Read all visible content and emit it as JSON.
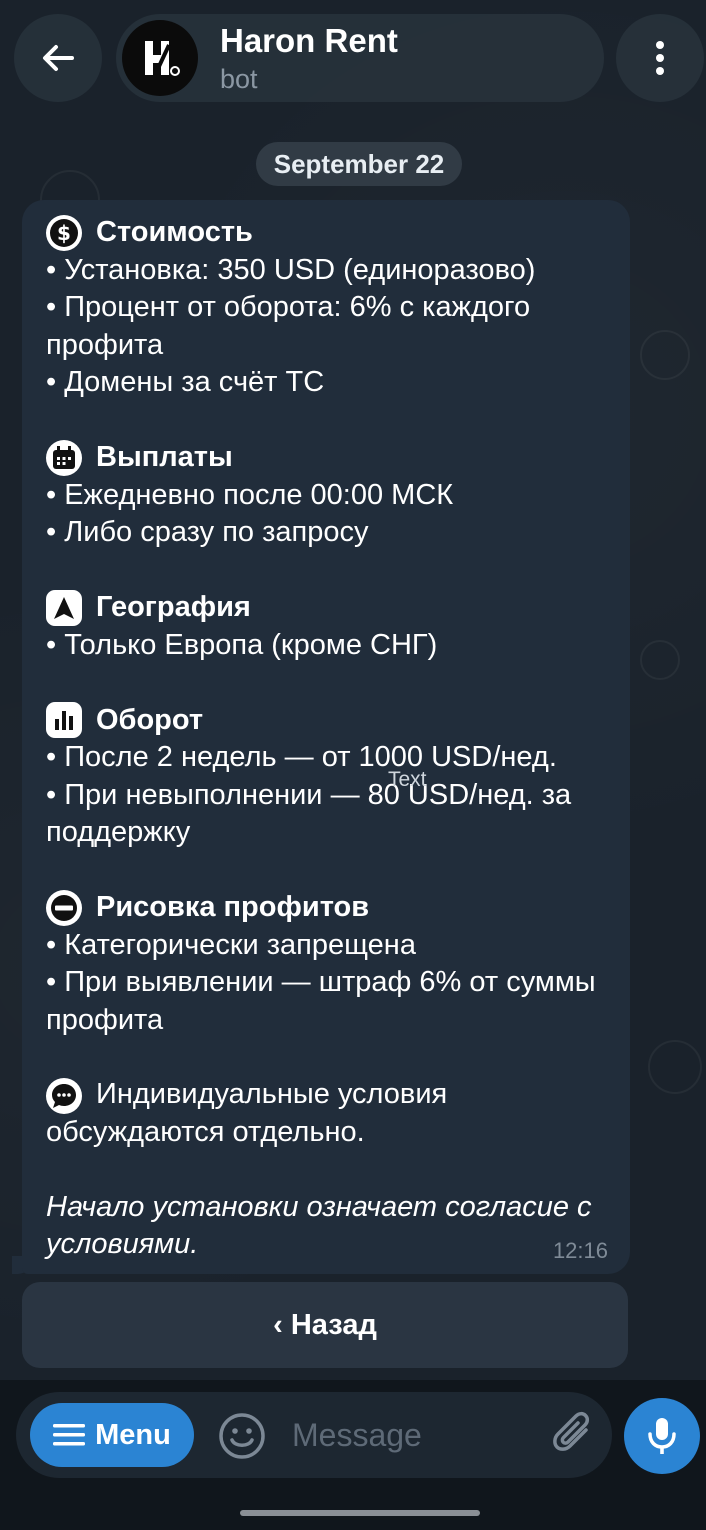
{
  "header": {
    "title": "Haron Rent",
    "subtitle": "bot"
  },
  "date_separator": "September 22",
  "message": {
    "sections": [
      {
        "icon": "dollar-icon",
        "heading": "Стоимость",
        "lines": [
          "• Установка: 350 USD (единоразово)",
          "• Процент от оборота: 6% с каждого профита",
          "• Домены за счёт ТС"
        ]
      },
      {
        "icon": "calendar-icon",
        "heading": "Выплаты",
        "lines": [
          "• Ежедневно после 00:00 МСК",
          "• Либо сразу по запросу"
        ]
      },
      {
        "icon": "navigation-arrow-icon",
        "heading": "География",
        "lines": [
          "• Только Европа (кроме СНГ)"
        ]
      },
      {
        "icon": "bar-chart-icon",
        "heading": "Оборот",
        "lines": [
          "• После 2 недель — от 1000 USD/нед.",
          "• При невыполнении — 80 USD/нед. за поддержку"
        ]
      },
      {
        "icon": "no-entry-icon",
        "heading": "Рисовка профитов",
        "lines": [
          "• Категорически запрещена",
          "• При выявлении — штраф 6% от суммы профита"
        ]
      }
    ],
    "individual_note": "Индивидуальные условия обсуждаются отдельно.",
    "footer_italic": "Начало установки означает согласие с условиями.",
    "time": "12:16",
    "overlay_label": "Text"
  },
  "keyboard": {
    "back_label": "‹ Назад"
  },
  "input_bar": {
    "menu_label": "Menu",
    "placeholder": "Message"
  },
  "colors": {
    "accent": "#2b84d3",
    "bubble": "#212d3b",
    "background": "#1a222b"
  }
}
